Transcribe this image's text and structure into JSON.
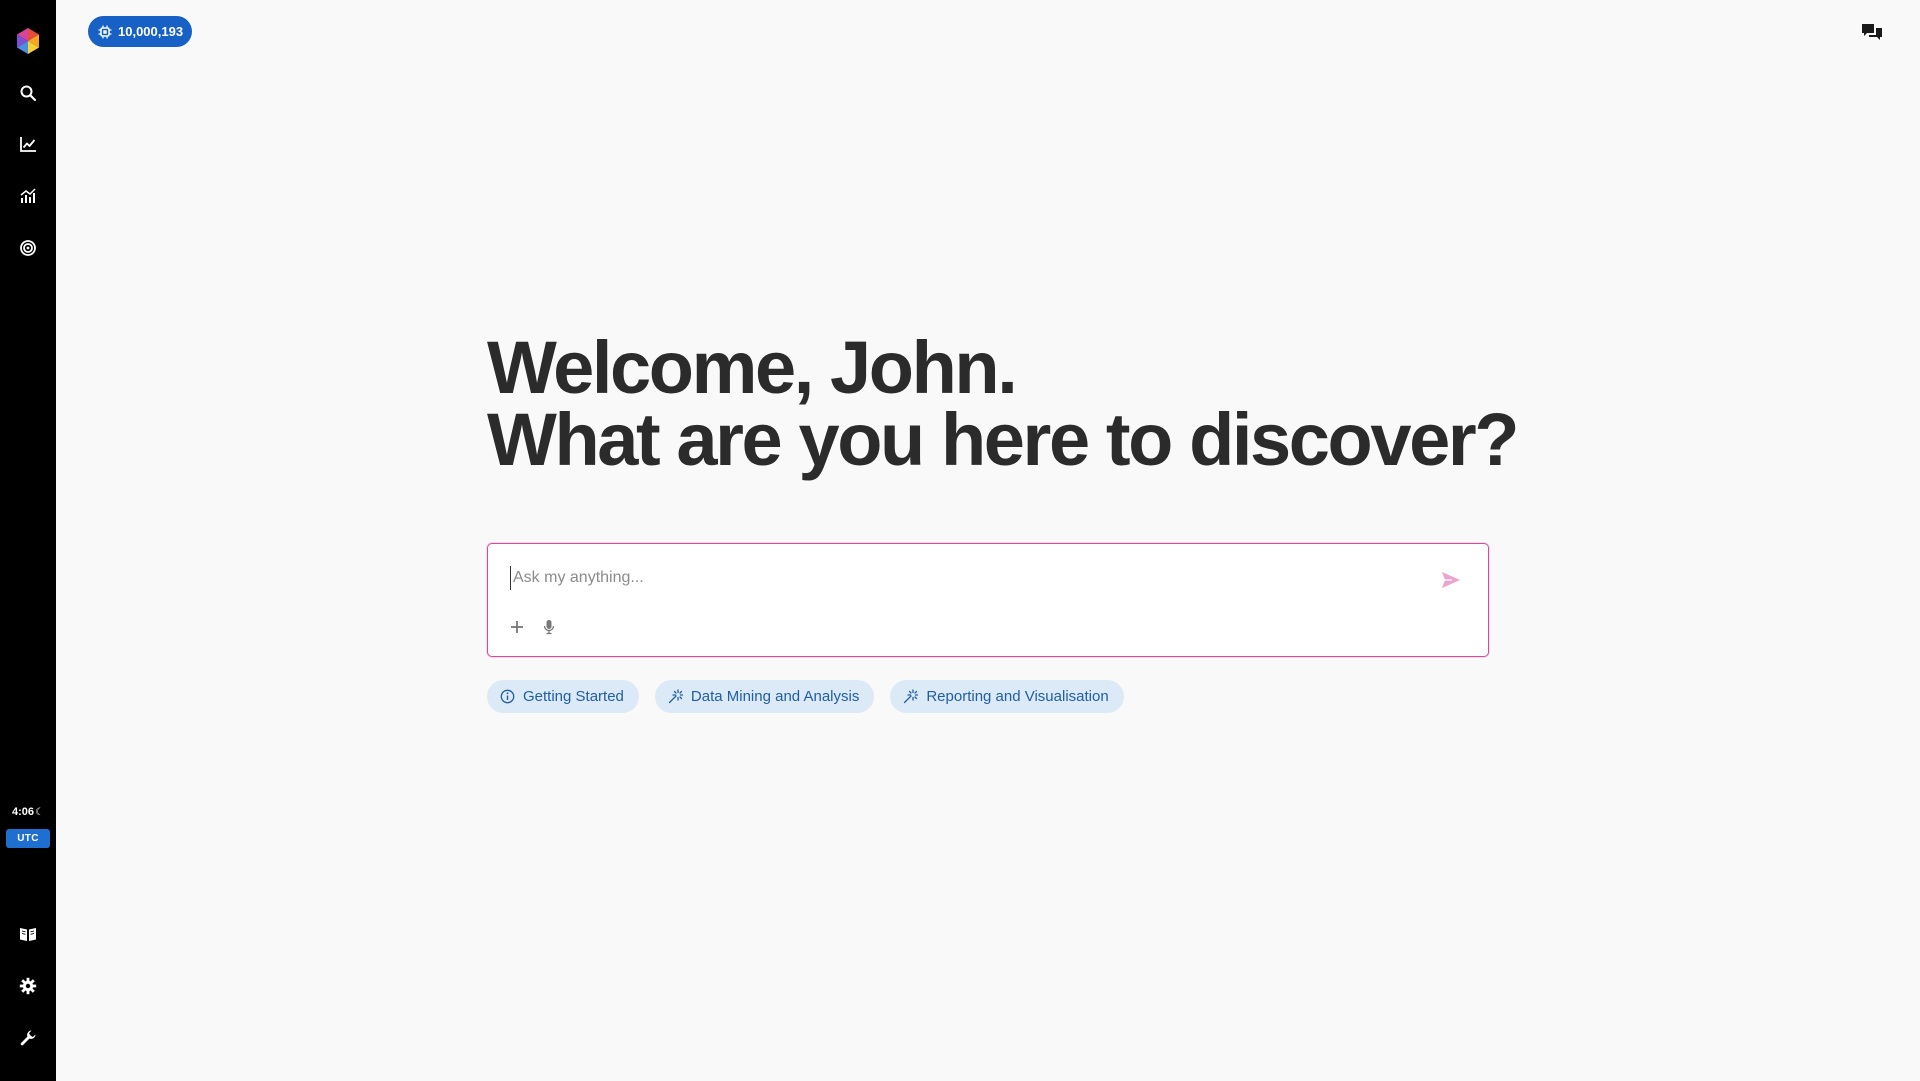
{
  "sidebar": {
    "items": [
      {
        "icon": "search-icon"
      },
      {
        "icon": "line-chart-icon"
      },
      {
        "icon": "analytics-icon"
      },
      {
        "icon": "target-icon"
      }
    ],
    "bottom_items": [
      {
        "icon": "book-icon"
      },
      {
        "icon": "gear-icon"
      },
      {
        "icon": "wrench-icon"
      }
    ],
    "clock": {
      "time": "4:06",
      "moon": "☾",
      "timezone": "UTC"
    }
  },
  "header": {
    "credits": "10,000,193"
  },
  "headline": {
    "line1": "Welcome, John.",
    "line2": "What are you here to discover?"
  },
  "ask": {
    "placeholder": "Ask my anything...",
    "value": ""
  },
  "chips": [
    {
      "label": "Getting Started",
      "icon": "info-icon"
    },
    {
      "label": "Data Mining and Analysis",
      "icon": "sparkle-icon"
    },
    {
      "label": "Reporting and Visualisation",
      "icon": "sparkle-icon"
    }
  ],
  "colors": {
    "sidebar": "#000000",
    "background": "#f9f9f9",
    "accent_blue": "#1660c6",
    "chip_bg": "#dce9f6",
    "chip_text": "#1f5ea8",
    "input_border": "#d94b8f",
    "send_icon": "#e8a6cf",
    "heading": "#2b2b2b"
  }
}
